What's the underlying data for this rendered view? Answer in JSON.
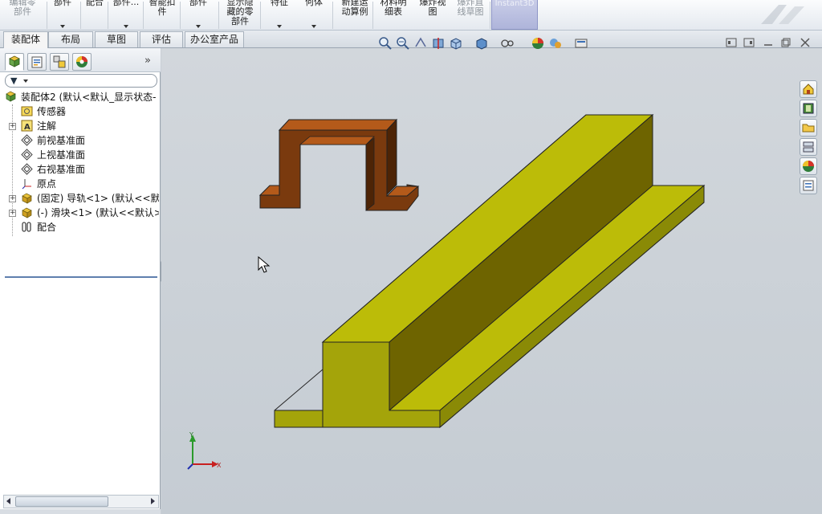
{
  "ribbon": {
    "buttons": [
      {
        "label": "编辑零\n部件",
        "disabled": true
      },
      {
        "label": "部件",
        "disabled": false,
        "arrow": true
      },
      {
        "label": "配合",
        "disabled": false
      },
      {
        "label": "部件...",
        "disabled": false,
        "arrow": true
      },
      {
        "label": "智能扣\n件",
        "disabled": false
      },
      {
        "label": "部件",
        "disabled": false,
        "arrow": true
      },
      {
        "label": "显示隐\n藏的零\n部件",
        "disabled": false
      },
      {
        "label": "特征",
        "disabled": false,
        "arrow": true
      },
      {
        "label": "何体",
        "disabled": false,
        "arrow": true
      },
      {
        "label": "新建运\n动算例",
        "disabled": false
      },
      {
        "label": "材料明\n细表",
        "disabled": false
      },
      {
        "label": "爆炸视\n图",
        "disabled": false
      },
      {
        "label": "爆炸直\n线草图",
        "disabled": true
      }
    ],
    "instant3d": "Instant3D"
  },
  "tabs": [
    {
      "label": "装配体",
      "active": true
    },
    {
      "label": "布局",
      "active": false
    },
    {
      "label": "草图",
      "active": false
    },
    {
      "label": "评估",
      "active": false
    },
    {
      "label": "办公室产品",
      "active": false
    }
  ],
  "panel": {
    "chevron": "»",
    "filter_icon": "filter-icon"
  },
  "tree": [
    {
      "label": "装配体2  (默认<默认_显示状态-",
      "icon": "assembly-icon",
      "indent": 0,
      "expander": false
    },
    {
      "label": "传感器",
      "icon": "sensor-icon",
      "indent": 1,
      "expander": false
    },
    {
      "label": "注解",
      "icon": "annotation-icon",
      "indent": 1,
      "expander": true
    },
    {
      "label": "前视基准面",
      "icon": "plane-icon",
      "indent": 1,
      "expander": false
    },
    {
      "label": "上视基准面",
      "icon": "plane-icon",
      "indent": 1,
      "expander": false
    },
    {
      "label": "右视基准面",
      "icon": "plane-icon",
      "indent": 1,
      "expander": false
    },
    {
      "label": "原点",
      "icon": "origin-icon",
      "indent": 1,
      "expander": false
    },
    {
      "label": "(固定) 导轨<1> (默认<<默认",
      "icon": "part-icon",
      "indent": 1,
      "expander": true
    },
    {
      "label": "(-) 滑块<1> (默认<<默认>_",
      "icon": "part-icon",
      "indent": 1,
      "expander": true
    },
    {
      "label": "配合",
      "icon": "mates-icon",
      "indent": 1,
      "expander": false
    }
  ],
  "triad": {
    "x": "X",
    "y": "Y"
  },
  "colors": {
    "rail_top": "#bcbc08",
    "rail_front": "#a4a40a",
    "rail_side": "#6e6400",
    "slider_top": "#b45a1a",
    "slider_front": "#7a3a0e",
    "slider_dark": "#4d2406",
    "viewport_bg": "#ccd2d8"
  }
}
